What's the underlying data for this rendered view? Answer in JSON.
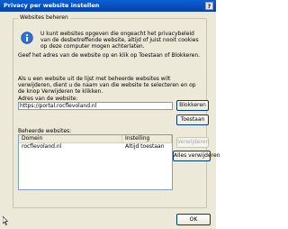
{
  "window": {
    "title": "Privacy per website instellen",
    "help_label": "?"
  },
  "group": {
    "label": "Websites beheren"
  },
  "text": {
    "intro": "U kunt websites opgeven die ongeacht het privacybeleid van de desbetreffende website, altijd of juist nooit cookies op deze computer mogen achterlaten.",
    "instruction_add": "Geef het adres van de website op en klik op Toestaan of Blokkeren.",
    "instruction_remove": "Als u een website uit de lijst met beheerde websites wilt verwijderen, dient u de naam van die website te selecteren en op de knop Verwijderen te klikken."
  },
  "address": {
    "label": "Adres van de website:",
    "value": "https://portal.rocflevoland.nl"
  },
  "buttons": {
    "block": "Blokkeren",
    "allow": "Toestaan",
    "remove": "Verwijderen",
    "remove_all": "Alles verwijderen",
    "ok": "OK"
  },
  "managed": {
    "label": "Beheerde websites:",
    "columns": [
      "Domein",
      "Instelling"
    ],
    "rows": [
      {
        "domain": "rocflevoland.nl",
        "setting": "Altijd toestaan"
      }
    ]
  }
}
